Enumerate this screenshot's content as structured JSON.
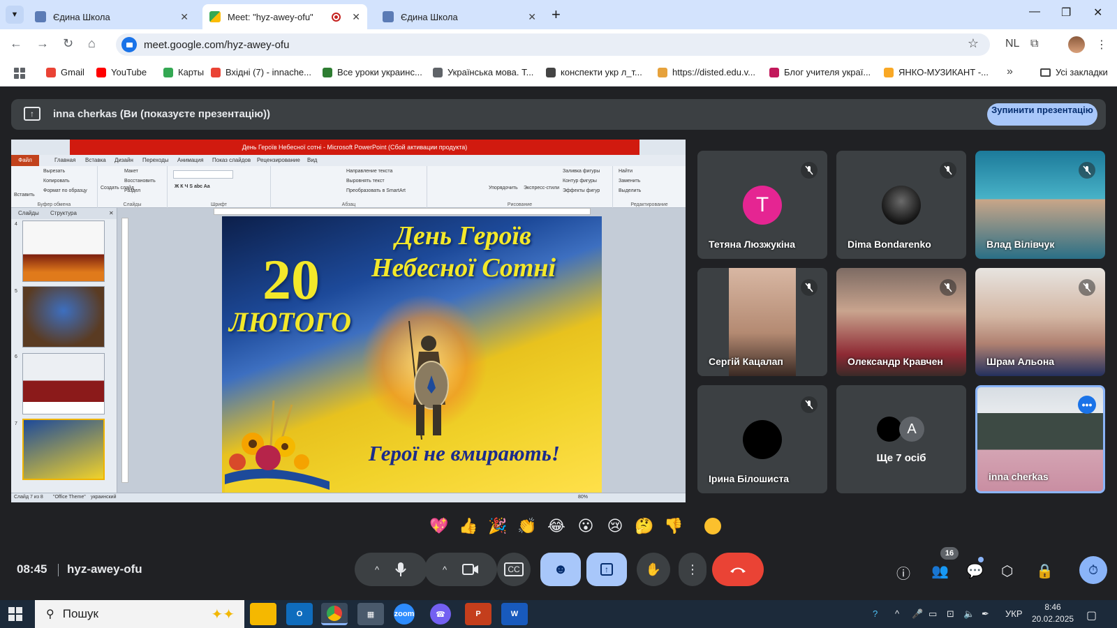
{
  "browser": {
    "tabs": [
      {
        "label": "Єдина Школа",
        "active": false
      },
      {
        "label": "Meet: \"hyz-awey-ofu\"",
        "active": true,
        "recording": true
      },
      {
        "label": "Єдина Школа",
        "active": false
      }
    ],
    "url": "meet.google.com/hyz-awey-ofu",
    "profile_badge": "NL",
    "bookmarks": [
      {
        "label": "Gmail",
        "icon": "gmail-icon",
        "color": "#ea4335"
      },
      {
        "label": "YouTube",
        "icon": "youtube-icon",
        "color": "#ff0000"
      },
      {
        "label": "Карты",
        "icon": "maps-icon",
        "color": "#34a853"
      },
      {
        "label": "Вхідні (7) - innache...",
        "icon": "gmail-icon",
        "color": "#ea4335"
      },
      {
        "label": "Все уроки украинс...",
        "icon": "bookmark-icon",
        "color": "#2e7d32"
      },
      {
        "label": "Українська мова. Т...",
        "icon": "bookmark-icon",
        "color": "#5f6368"
      },
      {
        "label": "конспекти укр л_т...",
        "icon": "globe-icon",
        "color": "#444444"
      },
      {
        "label": "https://disted.edu.v...",
        "icon": "bookmark-icon",
        "color": "#e6a23c"
      },
      {
        "label": "Блог учителя украї...",
        "icon": "bookmark-icon",
        "color": "#c2185b"
      },
      {
        "label": "ЯНКО-МУЗИКАНТ -...",
        "icon": "bookmark-icon",
        "color": "#f9a825"
      }
    ],
    "all_bookmarks": "Усі закладки"
  },
  "meet": {
    "presenting_banner": "inna cherkas (Ви (показуєте презентацію))",
    "stop_button": "Зупинити презентацію",
    "participants": [
      {
        "name": "Тетяна Люзжукіна",
        "initial": "T",
        "avatar_color": "#e52592",
        "muted": true
      },
      {
        "name": "Dima Bondarenko",
        "muted": true
      },
      {
        "name": "Влад Вілівчук",
        "muted": true
      },
      {
        "name": "Сергій Кацалап",
        "muted": true
      },
      {
        "name": "Олександр Кравчен",
        "muted": true
      },
      {
        "name": "Шрам Альона",
        "muted": true
      },
      {
        "name": "Ірина Білошиста",
        "muted": true
      },
      {
        "name": "Ще 7 осіб",
        "initial": "A"
      },
      {
        "name": "inna cherkas",
        "self": true
      }
    ],
    "reactions": [
      "💖",
      "👍",
      "🎉",
      "👏",
      "😂",
      "😮",
      "😢",
      "🤔",
      "👎"
    ],
    "time": "08:45",
    "meeting_code": "hyz-awey-ofu",
    "participant_count": "16"
  },
  "powerpoint": {
    "window_title": "День Героїв Небесної сотні - Microsoft PowerPoint (Сбой активации продукта)",
    "file_tab": "Файл",
    "ribbon_tabs": [
      "Главная",
      "Вставка",
      "Дизайн",
      "Переходы",
      "Анимация",
      "Показ слайдов",
      "Рецензирование",
      "Вид"
    ],
    "groups": [
      "Буфер обмена",
      "Слайды",
      "Шрифт",
      "Абзац",
      "Рисование",
      "Редактирование"
    ],
    "clipboard": [
      "Вставить",
      "Вырезать",
      "Копировать",
      "Формат по образцу"
    ],
    "slides_group": [
      "Создать слайд",
      "Макет",
      "Восстановить",
      "Раздел"
    ],
    "paragraph": [
      "Направление текста",
      "Выровнять текст",
      "Преобразовать в SmartArt"
    ],
    "drawing": [
      "Упорядочить",
      "Экспресс-стили",
      "Заливка фигуры",
      "Контур фигуры",
      "Эффекты фигур"
    ],
    "editing": [
      "Найти",
      "Заменить",
      "Выделить"
    ],
    "pane_tabs": [
      "Слайды",
      "Структура"
    ],
    "slide_numbers": [
      "4",
      "5",
      "6",
      "7"
    ],
    "status": {
      "slide": "Слайд 7 из 8",
      "theme": "\"Office Theme\"",
      "lang": "украинский",
      "zoom": "80%"
    },
    "slide_text": {
      "date_number": "20",
      "date_month": "ЛЮТОГО",
      "title_line1": "День Героїв",
      "title_line2": "Небесної Сотні",
      "bottom": "Герої не вмирають!"
    }
  },
  "taskbar": {
    "search": "Пошук",
    "lang": "УКР",
    "time": "8:46",
    "date": "20.02.2025"
  },
  "colors": {
    "meet_bg": "#202124",
    "tile_bg": "#3c4043",
    "accent_blue": "#a8c7fa",
    "end_call_red": "#ea4335"
  }
}
